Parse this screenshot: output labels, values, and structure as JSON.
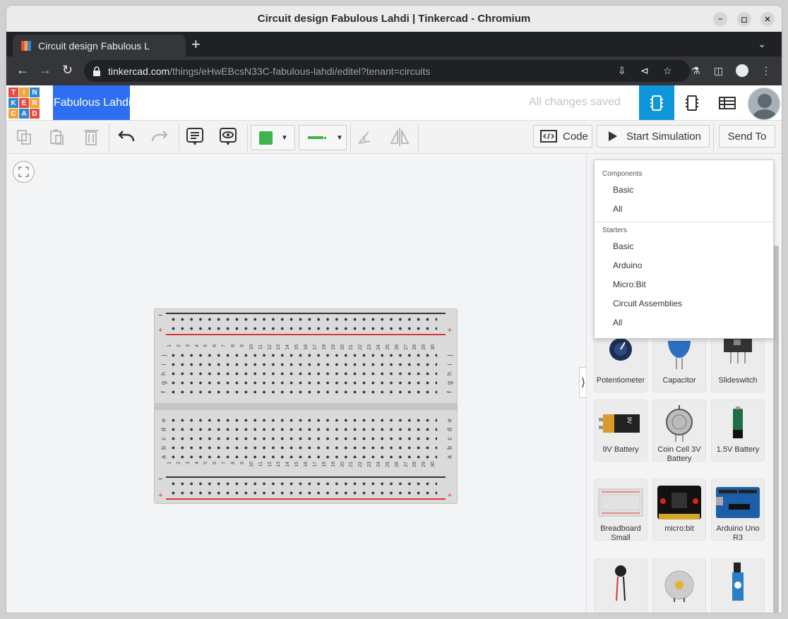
{
  "window": {
    "title": "Circuit design Fabulous Lahdi | Tinkercad - Chromium"
  },
  "tab": {
    "label": "Circuit design Fabulous L"
  },
  "address": {
    "host": "tinkercad.com",
    "path": "/things/eHwEBcsN33C-fabulous-lahdi/editel?tenant=circuits"
  },
  "app": {
    "logo_letters": [
      "T",
      "I",
      "N",
      "K",
      "E",
      "R",
      "C",
      "A",
      "D"
    ],
    "logo_colors": [
      "#e84b3c",
      "#f2a33a",
      "#2e87d1",
      "#2e87d1",
      "#e84b3c",
      "#f2a33a",
      "#f2a33a",
      "#2e87d1",
      "#e84b3c"
    ],
    "design_name": "Fabulous Lahdi",
    "save_status": "All changes saved",
    "accent": "#0d96d9"
  },
  "toolbar": {
    "code_label": "Code",
    "start_sim_label": "Start Simulation",
    "send_to_label": "Send To",
    "color_swatch": "#3cb54a",
    "wire_color": "#3cb54a"
  },
  "breadboard": {
    "minus": "−",
    "plus": "+",
    "row_letters_top": [
      "j",
      "i",
      "h",
      "g",
      "f"
    ],
    "row_letters_bottom": [
      "e",
      "d",
      "c",
      "b",
      "a"
    ],
    "columns": [
      "1",
      "2",
      "3",
      "4",
      "5",
      "6",
      "7",
      "8",
      "9",
      "10",
      "11",
      "12",
      "13",
      "14",
      "15",
      "16",
      "17",
      "18",
      "19",
      "20",
      "21",
      "22",
      "23",
      "24",
      "25",
      "26",
      "27",
      "28",
      "29",
      "30"
    ]
  },
  "dropdown": {
    "components_header": "Components",
    "components": [
      "Basic",
      "All"
    ],
    "starters_header": "Starters",
    "starters": [
      "Basic",
      "Arduino",
      "Micro:Bit",
      "Circuit Assemblies",
      "All"
    ]
  },
  "components": [
    {
      "label": "Potentiometer",
      "icon": "potentiometer-icon"
    },
    {
      "label": "Capacitor",
      "icon": "capacitor-icon"
    },
    {
      "label": "Slideswitch",
      "icon": "slideswitch-icon"
    },
    {
      "label": "9V Battery",
      "icon": "battery-9v-icon",
      "text": "9V"
    },
    {
      "label": "Coin Cell 3V Battery",
      "icon": "coin-cell-icon"
    },
    {
      "label": "1.5V Battery",
      "icon": "battery-aa-icon"
    },
    {
      "label": "Breadboard Small",
      "icon": "breadboard-icon"
    },
    {
      "label": "micro:bit",
      "icon": "microbit-icon"
    },
    {
      "label": "Arduino Uno R3",
      "icon": "arduino-icon"
    },
    {
      "label": "",
      "icon": "vibration-motor-icon"
    },
    {
      "label": "",
      "icon": "dc-motor-icon"
    },
    {
      "label": "",
      "icon": "servo-icon"
    }
  ]
}
